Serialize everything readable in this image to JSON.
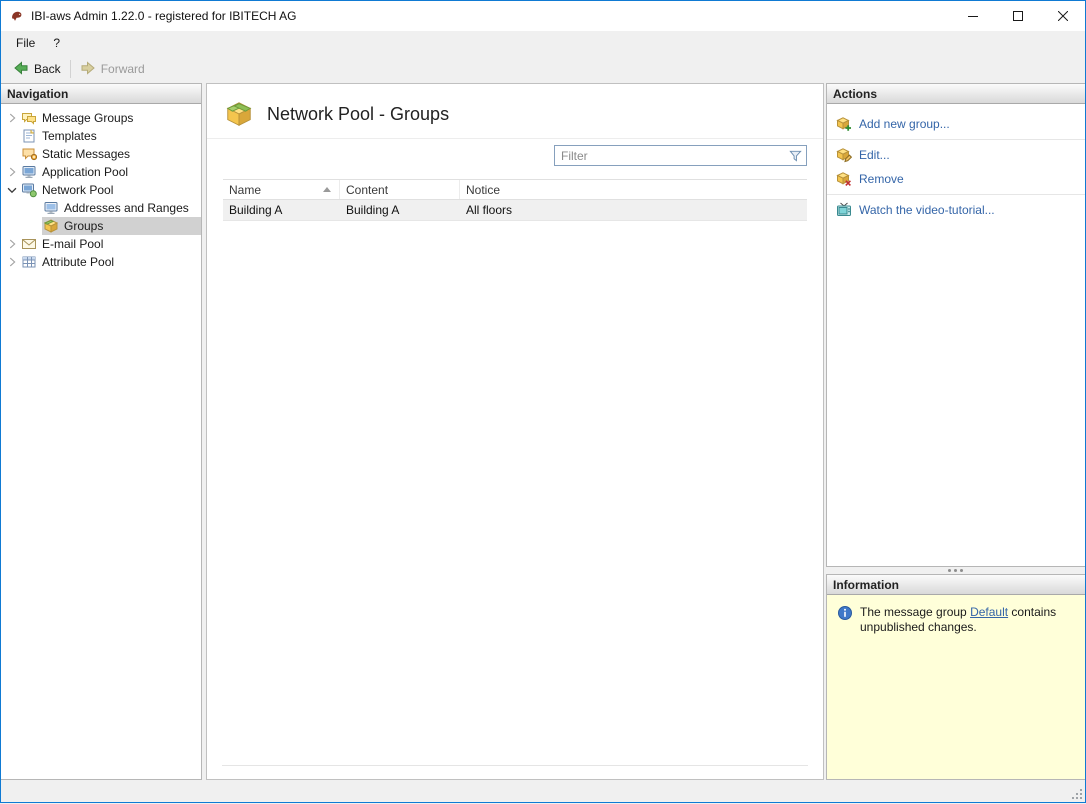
{
  "window": {
    "title": "IBI-aws Admin 1.22.0 - registered for IBITECH AG"
  },
  "menu": {
    "file": "File",
    "help": "?"
  },
  "toolbar": {
    "back": "Back",
    "forward": "Forward"
  },
  "navigation": {
    "header": "Navigation",
    "items": [
      {
        "label": "Message Groups",
        "icon": "message-groups-icon",
        "state": "collapsed"
      },
      {
        "label": "Templates",
        "icon": "templates-icon",
        "state": "leaf"
      },
      {
        "label": "Static Messages",
        "icon": "static-messages-icon",
        "state": "leaf"
      },
      {
        "label": "Application Pool",
        "icon": "application-pool-icon",
        "state": "collapsed"
      },
      {
        "label": "Network Pool",
        "icon": "network-pool-icon",
        "state": "expanded"
      },
      {
        "label": "Addresses and Ranges",
        "icon": "addresses-and-ranges-icon",
        "state": "leaf"
      },
      {
        "label": "Groups",
        "icon": "groups-icon",
        "state": "leaf",
        "selected": true
      },
      {
        "label": "E-mail Pool",
        "icon": "email-pool-icon",
        "state": "collapsed"
      },
      {
        "label": "Attribute Pool",
        "icon": "attribute-pool-icon",
        "state": "collapsed"
      }
    ]
  },
  "main": {
    "title": "Network Pool - Groups",
    "filter_placeholder": "Filter",
    "table": {
      "columns": [
        "Name",
        "Content",
        "Notice"
      ],
      "sort_column": "Name",
      "sort_direction": "ascending",
      "rows": [
        [
          "Building A",
          "Building A",
          "All floors"
        ]
      ]
    }
  },
  "actions": {
    "header": "Actions",
    "add": "Add new group...",
    "edit": "Edit...",
    "remove": "Remove",
    "tutorial": "Watch the video-tutorial..."
  },
  "information": {
    "header": "Information",
    "text_before_link": "The message group ",
    "link_text": "Default",
    "text_after_link": " contains unpublished changes."
  },
  "colors": {
    "window_border": "#0f7ad3",
    "link_blue": "#3465a8",
    "info_bg": "#ffffd9",
    "selection_bg": "#d1d1d1",
    "row_bg": "#f0f0f0"
  }
}
